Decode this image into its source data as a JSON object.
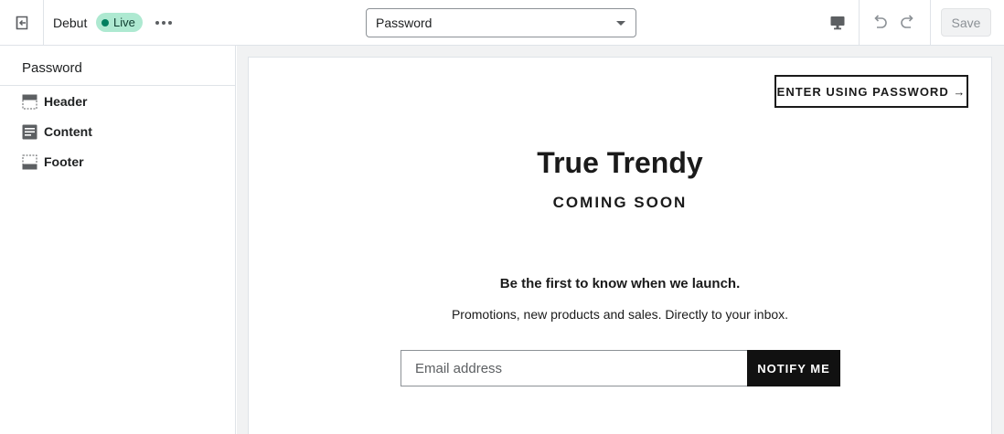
{
  "topbar": {
    "theme_name": "Debut",
    "status_badge": "Live",
    "page_select": {
      "selected": "Password"
    },
    "save_label": "Save"
  },
  "sidebar": {
    "title": "Password",
    "items": [
      {
        "label": "Header",
        "icon": "header-section-icon"
      },
      {
        "label": "Content",
        "icon": "content-section-icon"
      },
      {
        "label": "Footer",
        "icon": "footer-section-icon"
      }
    ]
  },
  "preview": {
    "enter_button": "ENTER USING PASSWORD →",
    "shop_title": "True Trendy",
    "coming_soon": "COMING SOON",
    "newsletter_heading": "Be the first to know when we launch.",
    "newsletter_text": "Promotions, new products and sales. Directly to your inbox.",
    "email_placeholder": "Email address",
    "notify_button": "NOTIFY ME"
  },
  "colors": {
    "live_badge_bg": "#aee9d1",
    "live_dot": "#007f5f",
    "primary_button": "#111111"
  }
}
